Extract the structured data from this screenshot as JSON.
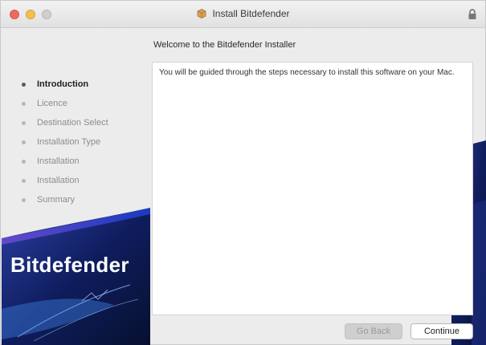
{
  "window": {
    "title": "Install Bitdefender",
    "icons": {
      "installer": "package-icon",
      "lock": "lock-icon"
    }
  },
  "sidebar": {
    "steps": [
      {
        "label": "Introduction",
        "active": true
      },
      {
        "label": "Licence",
        "active": false
      },
      {
        "label": "Destination Select",
        "active": false
      },
      {
        "label": "Installation Type",
        "active": false
      },
      {
        "label": "Installation",
        "active": false
      },
      {
        "label": "Installation",
        "active": false
      },
      {
        "label": "Summary",
        "active": false
      }
    ],
    "brand": "Bitdefender"
  },
  "content": {
    "heading": "Welcome to the Bitdefender Installer",
    "body": "You will be guided through the steps necessary to install this software on your Mac."
  },
  "buttons": {
    "back": "Go Back",
    "continue": "Continue"
  },
  "colors": {
    "accent_blue": "#2f5bd9",
    "deep_blue": "#0e1a4d",
    "purple": "#5b3fb5"
  }
}
